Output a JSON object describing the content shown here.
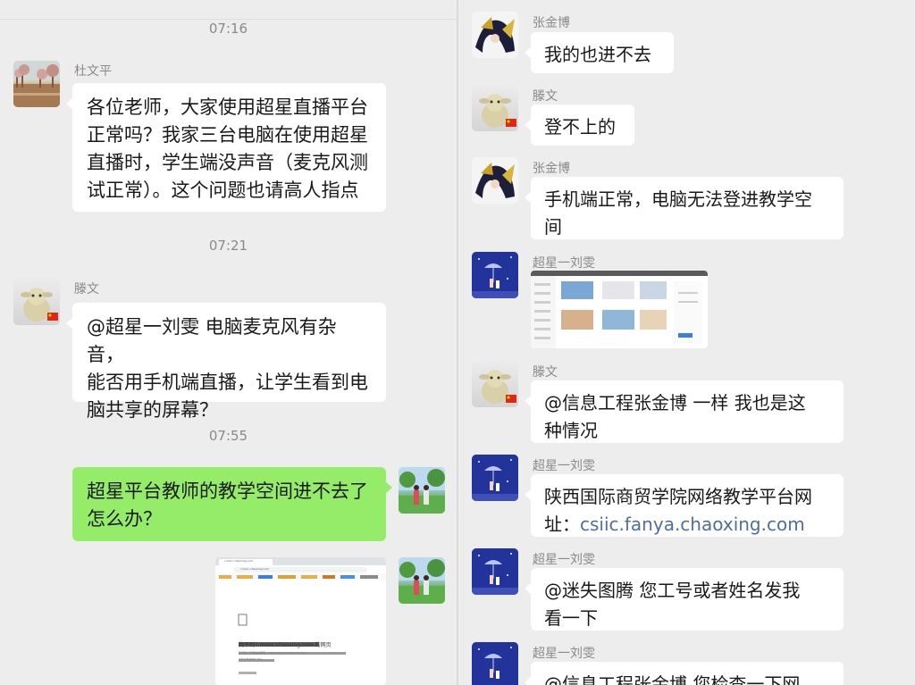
{
  "left": {
    "times": [
      "07:16",
      "07:21",
      "07:55"
    ],
    "messages": [
      {
        "sender": "杜文平",
        "avatar": "landscape-avatar",
        "lines": [
          "各位老师，大家使用超星直播平台",
          "正常吗？我家三台电脑在使用超星",
          "直播时，学生端没声音（麦克风测",
          "试正常）。这个问题也请高人指点"
        ]
      },
      {
        "sender": "滕文",
        "avatar": "sheep-avatar",
        "lines": [
          "@超星一刘雯  电脑麦克风有杂音，",
          "能否用手机端直播，让学生看到电",
          "脑共享的屏幕？"
        ]
      },
      {
        "sender": "",
        "avatar": "field-avatar",
        "self": true,
        "lines": [
          "超星平台教师的教学空间进不去了",
          "怎么办？"
        ]
      },
      {
        "sender": "",
        "avatar": "field-avatar",
        "self": true,
        "screenshot": {
          "tab_title": "i.mooc.chaoxing.com",
          "address": "i.mooc.chaoxing.com",
          "error_title": "找不到 i.mooc.chaoxing.com 的网页",
          "error_detail": "找不到以下网址的网页：http://i.mooc.chaoxing.com/",
          "error_code": "HTTP ERROR 404"
        }
      }
    ]
  },
  "right": {
    "messages": [
      {
        "sender": "张金博",
        "avatar": "anime-avatar",
        "lines": [
          "我的也进不去"
        ]
      },
      {
        "sender": "滕文",
        "avatar": "sheep-avatar",
        "lines": [
          "登不上的"
        ]
      },
      {
        "sender": "张金博",
        "avatar": "anime-avatar",
        "lines": [
          "手机端正常，电脑无法登进教学空",
          "间"
        ]
      },
      {
        "sender": "超星一刘雯",
        "avatar": "night-avatar",
        "image": "screenshot-thumbnail"
      },
      {
        "sender": "滕文",
        "avatar": "sheep-avatar",
        "lines": [
          "@信息工程张金博  一样 我也是这",
          "种情况"
        ]
      },
      {
        "sender": "超星一刘雯",
        "avatar": "night-avatar",
        "line1": "陕西国际商贸学院网络教学平台网",
        "line2_prefix": "址：",
        "link": "csiic.fanya.chaoxing.com"
      },
      {
        "sender": "超星一刘雯",
        "avatar": "night-avatar",
        "lines": [
          "@迷失图腾  您工号或者姓名发我",
          "看一下"
        ]
      },
      {
        "sender": "超星一刘雯",
        "avatar": "night-avatar",
        "lines": [
          "@信息工程张金博  您检查一下网"
        ]
      }
    ]
  },
  "colors": {
    "background": "#ededed",
    "bubble_self": "#95ec69",
    "bubble_other": "#ffffff",
    "link": "#4e6f9e",
    "timestamp": "#8a8a8a"
  }
}
